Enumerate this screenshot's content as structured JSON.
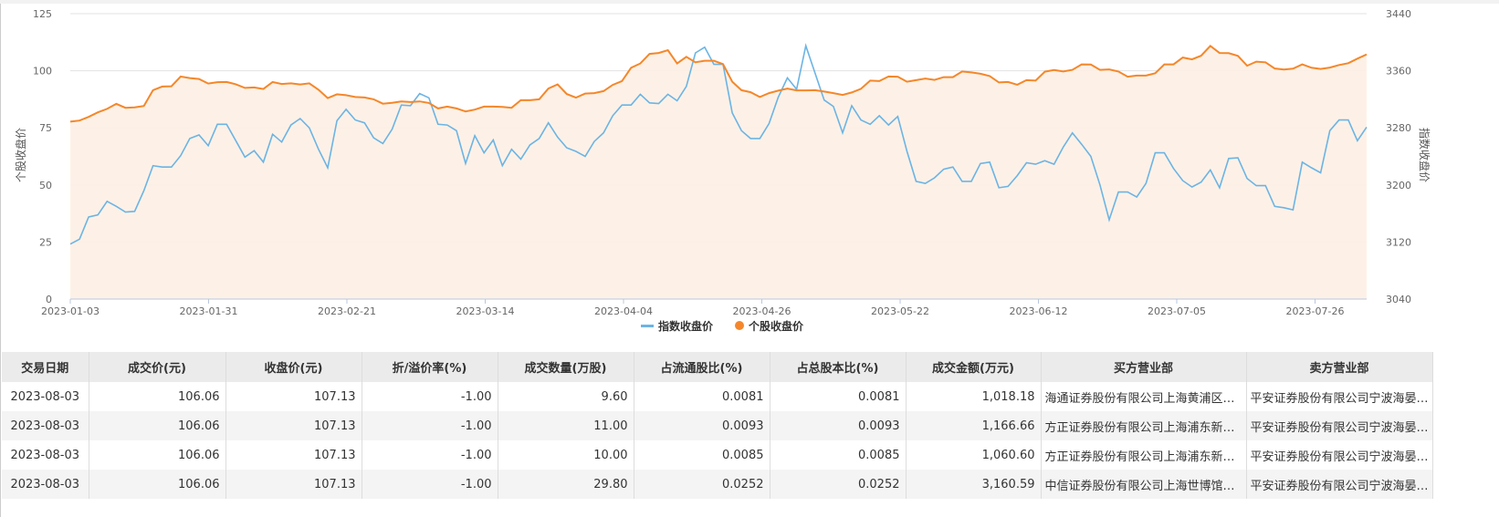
{
  "chart_data": {
    "type": "line",
    "y_left": {
      "label": "个股收盘价",
      "range": [
        0,
        125
      ],
      "ticks": [
        0,
        25,
        50,
        75,
        100,
        125
      ]
    },
    "y_right": {
      "label": "指数收盘价",
      "range": [
        3040,
        3440
      ],
      "ticks": [
        3040,
        3120,
        3200,
        3280,
        3360,
        3440
      ]
    },
    "x_tick_labels": [
      "2023-01-03",
      "2023-01-31",
      "2023-02-21",
      "2023-03-14",
      "2023-04-04",
      "2023-04-26",
      "2023-05-22",
      "2023-06-12",
      "2023-07-05",
      "2023-07-26"
    ],
    "x_range": [
      "2023-01-03",
      "2023-08-03"
    ],
    "grid": true,
    "legend_position": "bottom",
    "series": [
      {
        "name": "指数收盘价",
        "axis": "right",
        "color": "#6cb4e4",
        "values": [
          3117,
          3124,
          3155,
          3158,
          3177,
          3170,
          3162,
          3163,
          3192,
          3227,
          3225,
          3225,
          3241,
          3265,
          3270,
          3255,
          3285,
          3285,
          3262,
          3239,
          3248,
          3232,
          3271,
          3260,
          3284,
          3293,
          3280,
          3250,
          3224,
          3290,
          3306,
          3291,
          3287,
          3266,
          3258,
          3278,
          3312,
          3311,
          3328,
          3322,
          3285,
          3284,
          3276,
          3230,
          3269,
          3245,
          3263,
          3227,
          3250,
          3236,
          3256,
          3265,
          3287,
          3267,
          3252,
          3247,
          3240,
          3261,
          3273,
          3297,
          3312,
          3312,
          3327,
          3315,
          3314,
          3327,
          3318,
          3338,
          3385,
          3393,
          3369,
          3369,
          3301,
          3276,
          3265,
          3265,
          3286,
          3323,
          3350,
          3334,
          3395,
          3357,
          3319,
          3310,
          3273,
          3311,
          3291,
          3285,
          3297,
          3284,
          3296,
          3247,
          3205,
          3202,
          3210,
          3222,
          3225,
          3205,
          3205,
          3230,
          3232,
          3196,
          3198,
          3213,
          3231,
          3229,
          3234,
          3229,
          3253,
          3273,
          3257,
          3240,
          3200,
          3151,
          3190,
          3190,
          3183,
          3202,
          3245,
          3245,
          3223,
          3206,
          3197,
          3204,
          3221,
          3196,
          3237,
          3238,
          3209,
          3199,
          3199,
          3170,
          3168,
          3165,
          3232,
          3224,
          3217,
          3276,
          3291,
          3291,
          3262,
          3281
        ]
      },
      {
        "name": "个股收盘价",
        "axis": "left",
        "color": "#f5872a",
        "area": true,
        "values": [
          77.7,
          78.2,
          79.8,
          81.8,
          83.3,
          85.5,
          83.8,
          84.0,
          84.6,
          91.5,
          93.1,
          93.2,
          97.5,
          96.8,
          96.4,
          94.4,
          95.0,
          95.1,
          94.1,
          92.5,
          92.7,
          92.0,
          95.1,
          94.2,
          94.5,
          94.0,
          94.5,
          91.7,
          88.0,
          89.7,
          89.3,
          88.5,
          88.3,
          87.5,
          85.6,
          86.0,
          86.6,
          86.3,
          86.6,
          85.9,
          83.5,
          84.3,
          83.5,
          82.2,
          83.0,
          84.3,
          84.3,
          84.2,
          83.8,
          87.1,
          87.1,
          87.5,
          92.2,
          94.0,
          89.8,
          88.2,
          90.0,
          90.2,
          91.1,
          93.8,
          95.5,
          101.3,
          103.2,
          107.4,
          107.8,
          109.0,
          103.2,
          106.1,
          103.7,
          104.4,
          104.4,
          102.9,
          95.2,
          91.5,
          90.6,
          88.5,
          90.2,
          91.3,
          92.2,
          91.4,
          91.4,
          91.5,
          90.9,
          90.2,
          89.4,
          90.5,
          92.1,
          95.7,
          95.5,
          97.5,
          97.4,
          95.2,
          95.9,
          96.6,
          96.0,
          97.2,
          97.2,
          99.7,
          99.3,
          98.7,
          97.7,
          94.9,
          95.1,
          93.9,
          95.9,
          95.7,
          99.6,
          100.3,
          99.7,
          100.4,
          102.8,
          102.7,
          100.4,
          100.6,
          99.7,
          97.4,
          97.9,
          97.9,
          98.9,
          102.8,
          102.8,
          105.8,
          105.0,
          106.6,
          110.9,
          107.8,
          107.7,
          106.5,
          102.2,
          104.0,
          103.7,
          101.0,
          100.5,
          100.9,
          102.8,
          101.3,
          100.8,
          101.4,
          102.5,
          103.3,
          105.3,
          107.13
        ]
      }
    ]
  },
  "table": {
    "headers": [
      "交易日期",
      "成交价(元)",
      "收盘价(元)",
      "折/溢价率(%)",
      "成交数量(万股)",
      "占流通股比(%)",
      "占总股本比(%)",
      "成交金额(万元)",
      "买方营业部",
      "卖方营业部"
    ],
    "rows": [
      [
        "2023-08-03",
        "106.06",
        "107.13",
        "-1.00",
        "9.60",
        "0.0081",
        "0.0081",
        "1,018.18",
        "海通证券股份有限公司上海黄浦区…",
        "平安证券股份有限公司宁波海晏…"
      ],
      [
        "2023-08-03",
        "106.06",
        "107.13",
        "-1.00",
        "11.00",
        "0.0093",
        "0.0093",
        "1,166.66",
        "方正证券股份有限公司上海浦东新…",
        "平安证券股份有限公司宁波海晏…"
      ],
      [
        "2023-08-03",
        "106.06",
        "107.13",
        "-1.00",
        "10.00",
        "0.0085",
        "0.0085",
        "1,060.60",
        "方正证券股份有限公司上海浦东新…",
        "平安证券股份有限公司宁波海晏…"
      ],
      [
        "2023-08-03",
        "106.06",
        "107.13",
        "-1.00",
        "29.80",
        "0.0252",
        "0.0252",
        "3,160.59",
        "中信证券股份有限公司上海世博馆…",
        "平安证券股份有限公司宁波海晏…"
      ]
    ]
  }
}
